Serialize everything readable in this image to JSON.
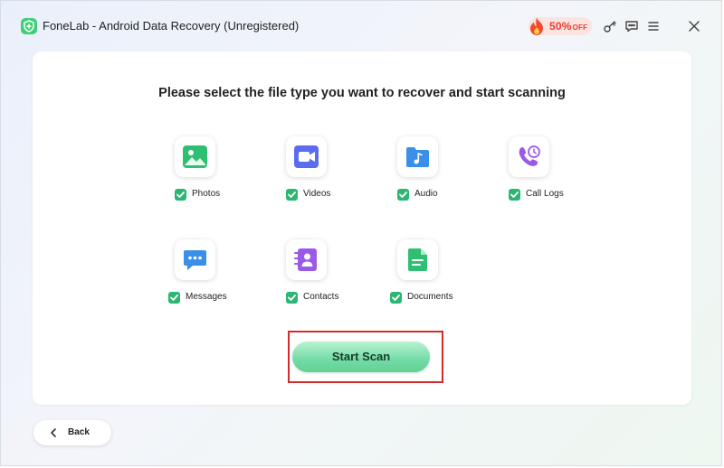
{
  "titlebar": {
    "app_logo_icon": "shield-plus-icon",
    "title": "FoneLab - Android Data Recovery (Unregistered)",
    "promo": {
      "discount": "50%",
      "suffix": "OFF",
      "icon": "fire-icon"
    },
    "icons": [
      "key-icon",
      "chat-icon",
      "menu-icon",
      "close-icon"
    ]
  },
  "main": {
    "heading": "Please select the file type you want to recover and start scanning",
    "file_types": [
      {
        "label": "Photos",
        "icon": "photo-icon",
        "checked": true
      },
      {
        "label": "Videos",
        "icon": "video-camera-icon",
        "checked": true
      },
      {
        "label": "Audio",
        "icon": "music-folder-icon",
        "checked": true
      },
      {
        "label": "Call Logs",
        "icon": "phone-clock-icon",
        "checked": true
      },
      {
        "label": "Messages",
        "icon": "message-bubble-icon",
        "checked": true
      },
      {
        "label": "Contacts",
        "icon": "contact-card-icon",
        "checked": true
      },
      {
        "label": "Documents",
        "icon": "document-icon",
        "checked": true
      }
    ],
    "start_scan_label": "Start Scan"
  },
  "footer": {
    "back_label": "Back",
    "back_icon": "chevron-left-icon"
  },
  "colors": {
    "accent_green": "#2bb673",
    "start_scan_button": "#73dba6",
    "promo_red": "#ef3a2c",
    "highlight_frame": "#d42a2a"
  }
}
